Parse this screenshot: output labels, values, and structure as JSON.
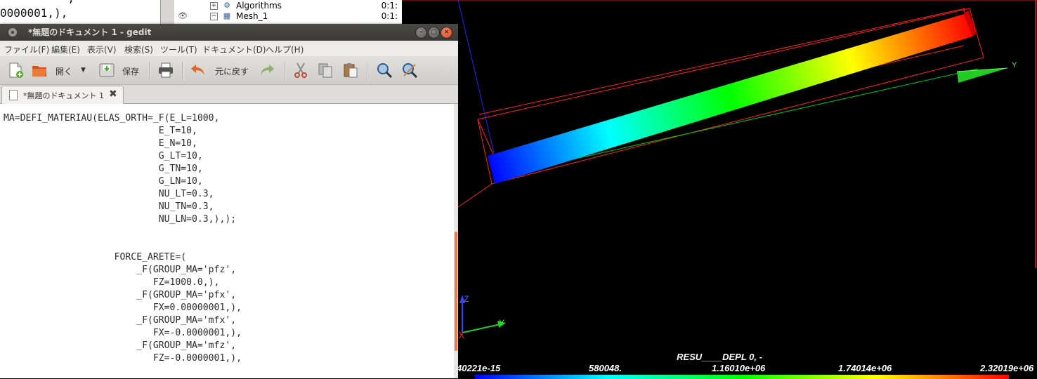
{
  "background_editor": {
    "line_partial_top": "          ,",
    "line_visible": "0000001,),"
  },
  "object_browser": {
    "rows": [
      {
        "expander": "+",
        "name": "Algorithms",
        "value": "0:1:"
      },
      {
        "expander": "−",
        "name": "Mesh_1",
        "value": "0:1:"
      }
    ]
  },
  "gedit": {
    "title": "*無題のドキュメント 1 - gedit",
    "menu": [
      "ファイル(F)",
      "編集(E)",
      "表示(V)",
      "検索(S)",
      "ツール(T)",
      "ドキュメント(D)",
      "ヘルプ(H)"
    ],
    "toolbar": {
      "open_label": "開く",
      "save_label": "保存",
      "undo_label": "元に戻す"
    },
    "tab_label": "*無題のドキュメント 1",
    "code_lines": [
      "MA=DEFI_MATERIAU(ELAS_ORTH=_F(E_L=1000,",
      "                            E_T=10,",
      "                            E_N=10,",
      "                            G_LT=10,",
      "                            G_TN=10,",
      "                            G_LN=10,",
      "                            NU_LT=0.3,",
      "                            NU_TN=0.3,",
      "                            NU_LN=0.3,),);",
      "",
      "",
      "                    FORCE_ARETE=(",
      "                        _F(GROUP_MA='pfz',",
      "                           FZ=1000.0,),",
      "                        _F(GROUP_MA='pfx',",
      "                           FX=0.00000001,),",
      "                        _F(GROUP_MA='mfx',",
      "                           FX=-0.0000001,),",
      "                        _F(GROUP_MA='mfz',",
      "                           FZ=-0.0000001,),"
    ]
  },
  "viewer": {
    "scalar_bar": {
      "title": "RESU____DEPL 0, -",
      "labels": [
        "40221e-15",
        "580048.",
        "1.16010e+06",
        "1.74014e+06",
        "2.32019e+06"
      ],
      "min_color": "#0000ff",
      "max_color": "#ff0000"
    },
    "axes": {
      "z_label": "Z",
      "y_label": "Y",
      "x_label": "X",
      "y_arrow_label": "Y"
    }
  }
}
